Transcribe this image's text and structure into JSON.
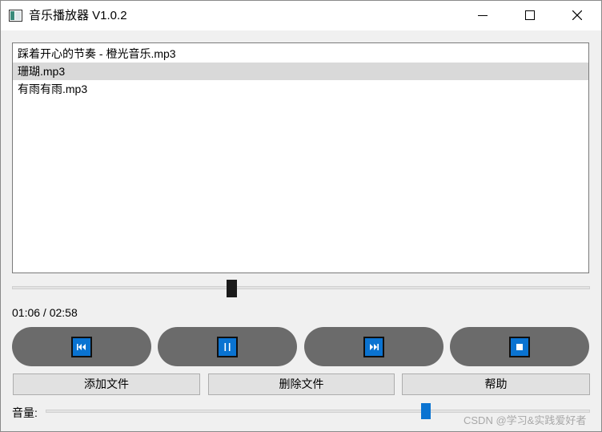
{
  "window": {
    "title": "音乐播放器 V1.0.2",
    "controls": {
      "minimize": "minimize-icon",
      "maximize": "maximize-icon",
      "close": "close-icon"
    }
  },
  "playlist": {
    "items": [
      {
        "label": "踩着开心的节奏 - 橙光音乐.mp3",
        "selected": false
      },
      {
        "label": "珊瑚.mp3",
        "selected": true
      },
      {
        "label": "有雨有雨.mp3",
        "selected": false
      }
    ]
  },
  "progress": {
    "time_text": "01:06 / 02:58",
    "fraction": 0.379
  },
  "controls": {
    "buttons": [
      {
        "name": "previous",
        "icon": "skip-previous-icon"
      },
      {
        "name": "pause",
        "icon": "pause-icon"
      },
      {
        "name": "next",
        "icon": "skip-next-icon"
      },
      {
        "name": "stop",
        "icon": "stop-icon"
      }
    ],
    "accent_color": "#0a73d1",
    "button_color": "#6b6b6b"
  },
  "actions": {
    "add_label": "添加文件",
    "delete_label": "删除文件",
    "help_label": "帮助"
  },
  "volume": {
    "label": "音量:",
    "fraction": 0.699
  },
  "watermark": "CSDN @学习&实践爱好者"
}
